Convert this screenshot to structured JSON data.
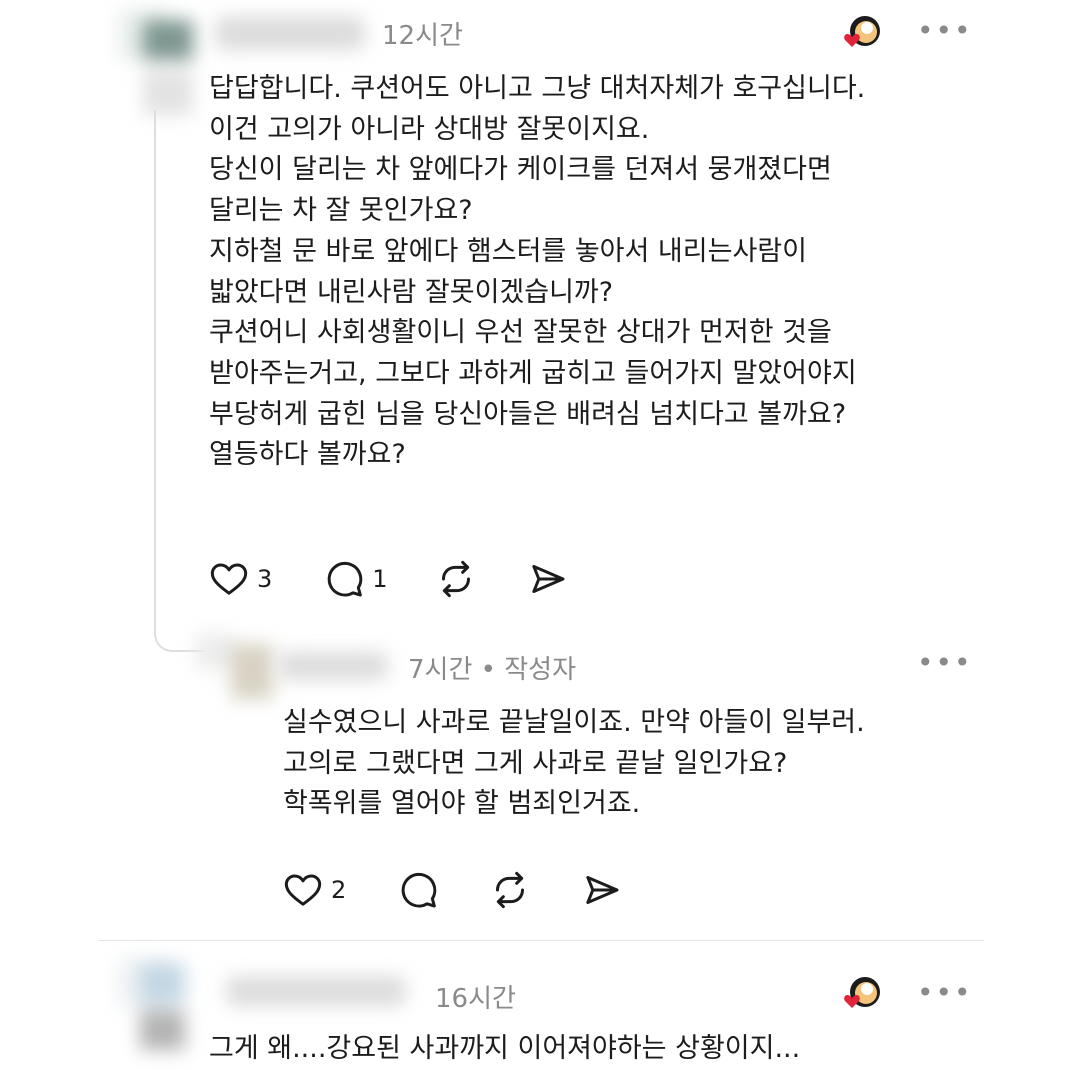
{
  "comments": [
    {
      "time": "12시간",
      "lines": [
        "답답합니다. 쿠션어도 아니고 그냥 대처자체가 호구십니다.",
        "이건 고의가 아니라 상대방 잘못이지요.",
        "당신이 달리는 차 앞에다가 케이크를 던져서 뭉개졌다면",
        "달리는 차 잘 못인가요?",
        "지하철 문 바로 앞에다 햄스터를 놓아서 내리는사람이",
        "밟았다면 내린사람 잘못이겠습니까?",
        "쿠션어니 사회생활이니 우선 잘못한 상대가 먼저한 것을",
        "받아주는거고, 그보다 과하게 굽히고 들어가지 말았어야지",
        "부당허게 굽힌 님을 당신아들은 배려심 넘치다고 볼까요?",
        "열등하다 볼까요?"
      ],
      "likes": "3",
      "replies": "1"
    },
    {
      "time": "7시간 • 작성자",
      "lines": [
        "실수였으니 사과로 끝날일이죠. 만약 아들이 일부러.",
        "고의로 그랬다면 그게 사과로 끝날 일인가요?",
        "학폭위를 열어야 할 범죄인거죠."
      ],
      "likes": "2",
      "replies": ""
    },
    {
      "time": "16시간",
      "lines": [
        "그게 왜....강요된 사과까지 이어져야하는 상황이지..."
      ]
    }
  ],
  "icons": {
    "more": "more-horizontal-icon",
    "like": "heart-icon",
    "reply": "speech-bubble-icon",
    "repost": "repost-icon",
    "share": "send-icon",
    "reaction": "heart-face-badge-icon"
  },
  "more_glyph": "•••",
  "colors": {
    "text": "#1c1c1c",
    "meta": "#8a8a8a",
    "heart_badge": "#e0243a"
  }
}
